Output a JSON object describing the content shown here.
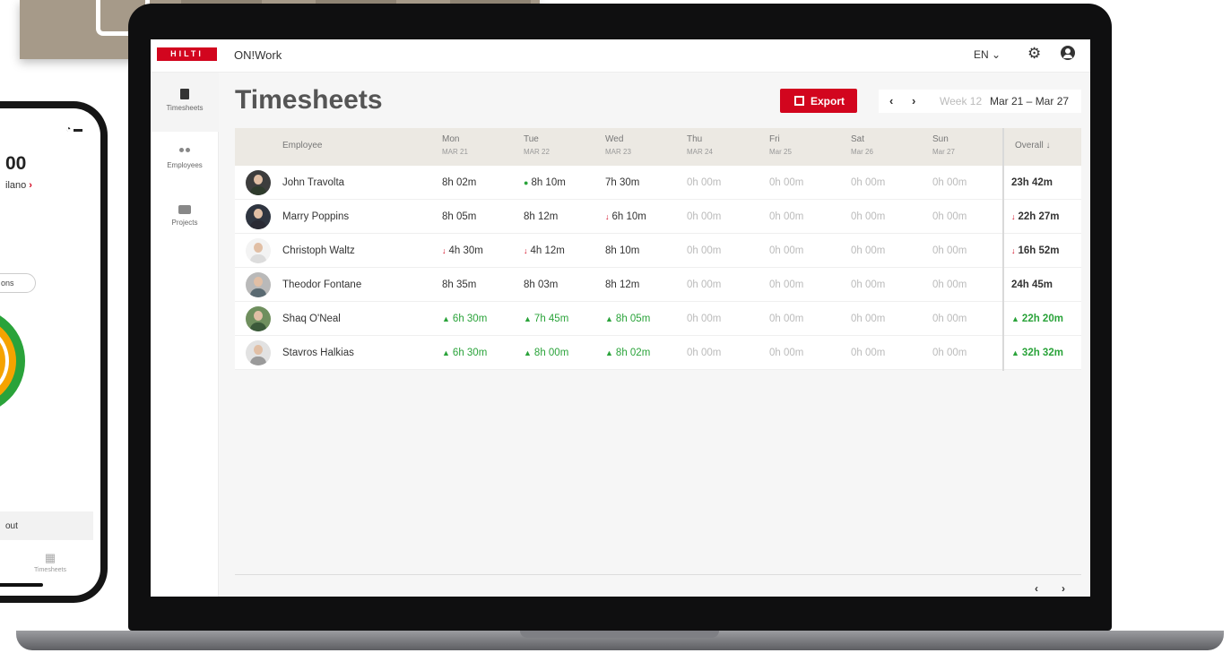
{
  "phone": {
    "time": "00",
    "location": "ilano",
    "chevron": "›",
    "pill": "ons",
    "row_label": "out",
    "tab_label": "Timesheets",
    "tab_icon": "calendar-icon"
  },
  "app": {
    "logo": "HILTI",
    "name": "ON!Work",
    "language": "EN",
    "language_chevron": "⌄",
    "gear_glyph": "⚙"
  },
  "sidebar": {
    "items": [
      {
        "label": "Timesheets",
        "icon": "document-icon",
        "active": true
      },
      {
        "label": "Employees",
        "icon": "people-icon",
        "active": false
      },
      {
        "label": "Projects",
        "icon": "briefcase-icon",
        "active": false
      }
    ]
  },
  "page": {
    "title": "Timesheets",
    "export_label": "Export",
    "prev_glyph": "‹",
    "next_glyph": "›",
    "week_label": "Week 12",
    "week_range": "Mar 21 – Mar 27"
  },
  "table": {
    "employee_header": "Employee",
    "overall_header": "Overall",
    "overall_sort_glyph": "↓",
    "days": [
      {
        "day": "Mon",
        "date": "MAR 21"
      },
      {
        "day": "Tue",
        "date": "MAR 22"
      },
      {
        "day": "Wed",
        "date": "MAR 23"
      },
      {
        "day": "Thu",
        "date": "MAR 24"
      },
      {
        "day": "Fri",
        "date": "Mar 25"
      },
      {
        "day": "Sat",
        "date": "Mar 26"
      },
      {
        "day": "Sun",
        "date": "Mar 27"
      }
    ],
    "rows": [
      {
        "name": "John Travolta",
        "cells": [
          "8h 02m",
          "8h 10m",
          "7h 30m",
          "0h 00m",
          "0h 00m",
          "0h 00m",
          "0h 00m"
        ],
        "marks": [
          "",
          "dot",
          "",
          "",
          "",
          "",
          ""
        ],
        "overall": "23h 42m",
        "overall_mark": ""
      },
      {
        "name": "Marry Poppins",
        "cells": [
          "8h 05m",
          "8h 12m",
          "6h 10m",
          "0h 00m",
          "0h 00m",
          "0h 00m",
          "0h 00m"
        ],
        "marks": [
          "",
          "",
          "down",
          "",
          "",
          "",
          ""
        ],
        "overall": "22h 27m",
        "overall_mark": "down"
      },
      {
        "name": "Christoph Waltz",
        "cells": [
          "4h 30m",
          "4h 12m",
          "8h 10m",
          "0h 00m",
          "0h 00m",
          "0h 00m",
          "0h 00m"
        ],
        "marks": [
          "down",
          "down",
          "",
          "",
          "",
          "",
          ""
        ],
        "overall": "16h 52m",
        "overall_mark": "down"
      },
      {
        "name": "Theodor Fontane",
        "cells": [
          "8h 35m",
          "8h 03m",
          "8h 12m",
          "0h 00m",
          "0h 00m",
          "0h 00m",
          "0h 00m"
        ],
        "marks": [
          "",
          "",
          "",
          "",
          "",
          "",
          ""
        ],
        "overall": "24h 45m",
        "overall_mark": ""
      },
      {
        "name": "Shaq O'Neal",
        "cells": [
          "6h 30m",
          "7h 45m",
          "8h 05m",
          "0h 00m",
          "0h 00m",
          "0h 00m",
          "0h 00m"
        ],
        "marks": [
          "lock",
          "lock",
          "lock",
          "",
          "",
          "",
          ""
        ],
        "overall": "22h 20m",
        "overall_mark": "lock"
      },
      {
        "name": "Stavros Halkias",
        "cells": [
          "6h 30m",
          "8h 00m",
          "8h 02m",
          "0h 00m",
          "0h 00m",
          "0h 00m",
          "0h 00m"
        ],
        "marks": [
          "lock",
          "lock",
          "lock",
          "",
          "",
          "",
          ""
        ],
        "overall": "32h 32m",
        "overall_mark": "lock"
      }
    ]
  },
  "pager": {
    "prev_glyph": "‹",
    "next_glyph": "›"
  },
  "colors": {
    "brand": "#d2051e",
    "good": "#2aa33a",
    "header_bg": "#ece9e3"
  }
}
